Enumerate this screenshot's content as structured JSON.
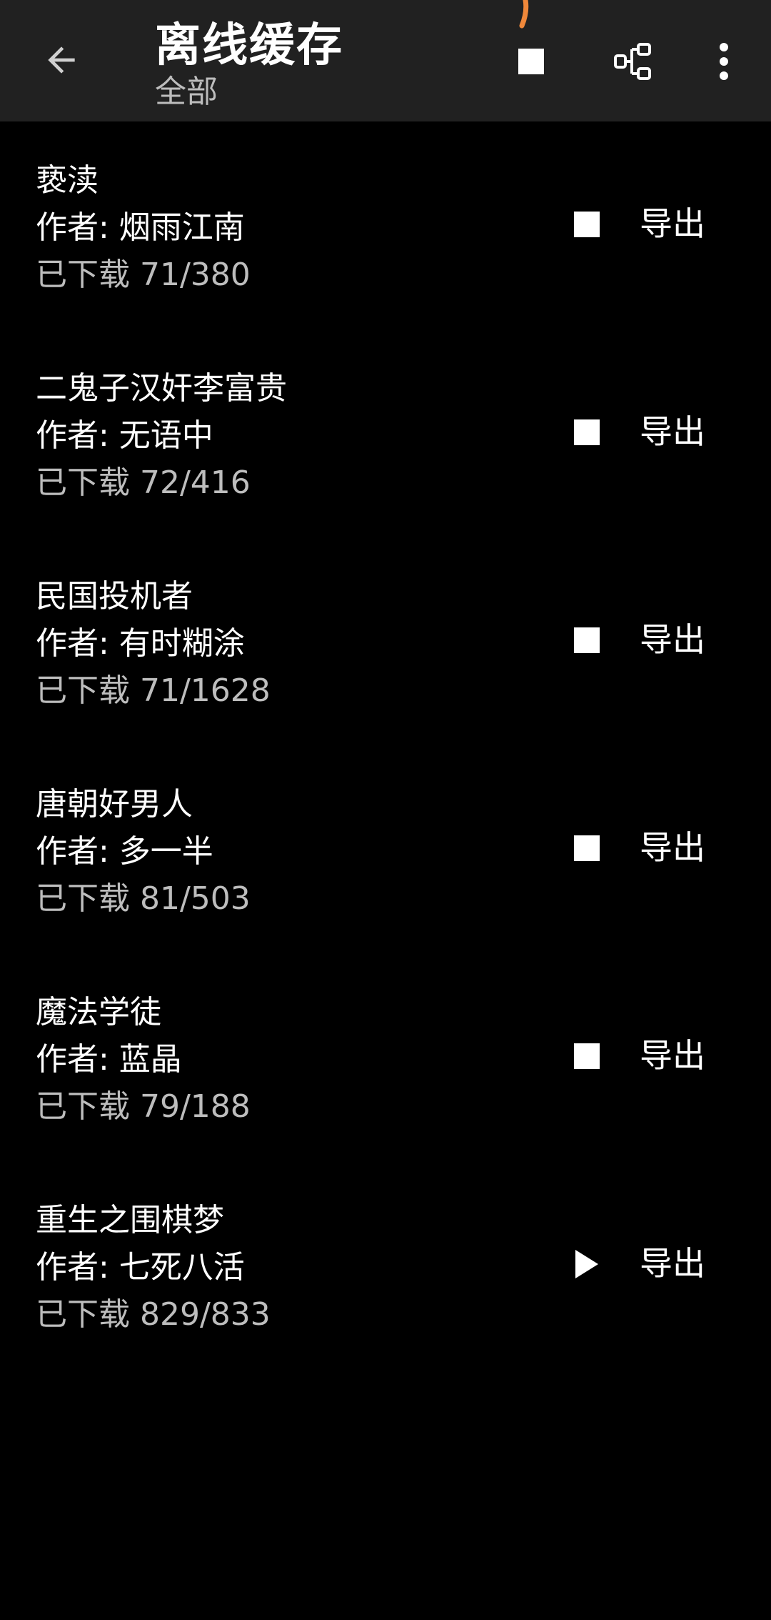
{
  "header": {
    "title": "离线缓存",
    "subtitle": "全部"
  },
  "colors": {
    "appbar": "#212121",
    "background": "#000000",
    "text_primary": "#ffffff",
    "text_secondary": "#bdbdbd",
    "refresh_accent": "#f0883a"
  },
  "icons": {
    "back": "arrow-left-icon",
    "stop_all": "stop-icon",
    "tree": "tree-structure-icon",
    "more": "more-vert-icon"
  },
  "books": [
    {
      "title": "亵渎",
      "author": "作者: 烟雨江南",
      "progress": "已下载 71/380",
      "state": "stop",
      "export": "导出"
    },
    {
      "title": "二鬼子汉奸李富贵",
      "author": "作者: 无语中",
      "progress": "已下载 72/416",
      "state": "stop",
      "export": "导出"
    },
    {
      "title": "民国投机者",
      "author": "作者: 有时糊涂",
      "progress": "已下载 71/1628",
      "state": "stop",
      "export": "导出"
    },
    {
      "title": "唐朝好男人",
      "author": "作者: 多一半",
      "progress": "已下载 81/503",
      "state": "stop",
      "export": "导出"
    },
    {
      "title": "魔法学徒",
      "author": "作者: 蓝晶",
      "progress": "已下载 79/188",
      "state": "stop",
      "export": "导出"
    },
    {
      "title": "重生之围棋梦",
      "author": "作者: 七死八活",
      "progress": "已下载 829/833",
      "state": "play",
      "export": "导出"
    }
  ]
}
